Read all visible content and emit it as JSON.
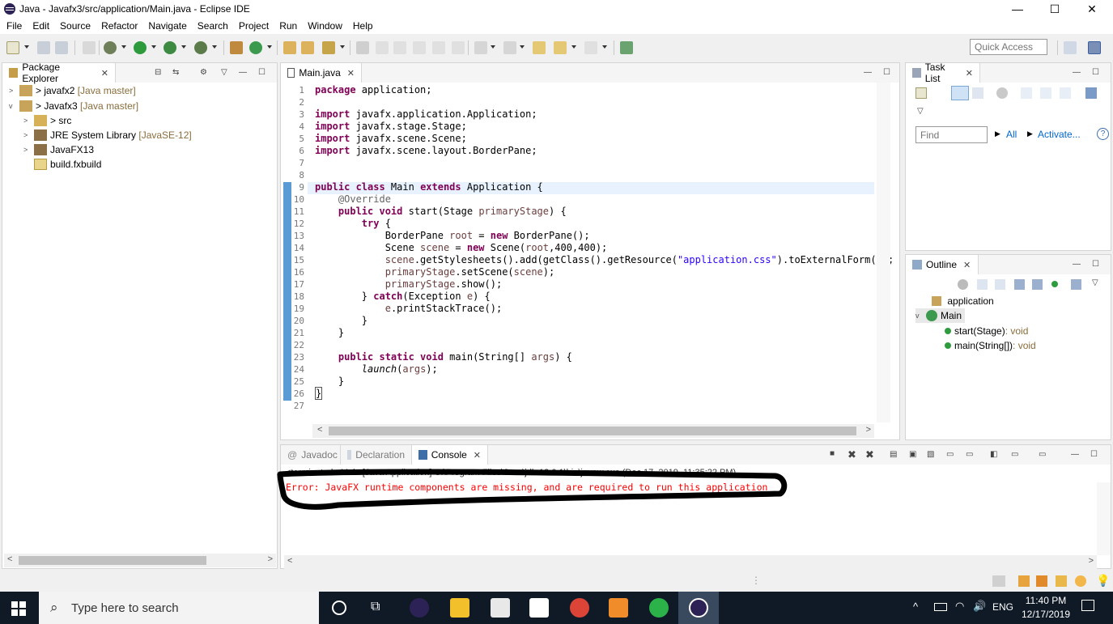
{
  "window": {
    "title": "Java - Javafx3/src/application/Main.java - Eclipse IDE",
    "min": "—",
    "max": "☐",
    "close": "✕"
  },
  "menu": [
    "File",
    "Edit",
    "Source",
    "Refactor",
    "Navigate",
    "Search",
    "Project",
    "Run",
    "Window",
    "Help"
  ],
  "toolbar": {
    "quick_access": "Quick Access"
  },
  "package_explorer": {
    "tab": "Package Explorer",
    "items": [
      {
        "label": "> javafx2",
        "tag": "[Java master]"
      },
      {
        "label": "> Javafx3",
        "tag": "[Java master]"
      },
      {
        "label": "> src",
        "tag": ""
      },
      {
        "label": "JRE System Library",
        "tag": "[JavaSE-12]"
      },
      {
        "label": "JavaFX13",
        "tag": ""
      },
      {
        "label": "build.fxbuild",
        "tag": ""
      }
    ]
  },
  "editor": {
    "tab": "Main.java",
    "line_numbers": [
      "1",
      "2",
      "3",
      "4",
      "5",
      "6",
      "7",
      "8",
      "9",
      "10",
      "11",
      "12",
      "13",
      "14",
      "15",
      "16",
      "17",
      "18",
      "19",
      "20",
      "21",
      "22",
      "23",
      "24",
      "25",
      "26",
      "27"
    ]
  },
  "task_list": {
    "tab": "Task List",
    "find_placeholder": "Find",
    "all": "All",
    "activate": "Activate..."
  },
  "outline": {
    "tab": "Outline",
    "items": [
      {
        "label": "application",
        "type": ""
      },
      {
        "label": "Main",
        "type": ""
      },
      {
        "label": "start(Stage)",
        "type": " : void"
      },
      {
        "label": "main(String[])",
        "type": " : void"
      }
    ]
  },
  "bottom": {
    "tabs": [
      "Javadoc",
      "Declaration",
      "Console"
    ],
    "terminated": "<terminated> Main [Java Application] C:\\Program Files\\Java\\jdk-13.0.1\\bin\\javaw.exe (Dec 17, 2019, 11:35:22 PM)",
    "error": "Error: JavaFX runtime components are missing, and are required to run this application"
  },
  "taskbar": {
    "search_placeholder": "Type here to search",
    "lang": "ENG",
    "time": "11:40 PM",
    "date": "12/17/2019"
  },
  "colors": {
    "error_red": "#ff0000",
    "accent_blue": "#0078d7",
    "keyword": "#7f0055",
    "string": "#2a00ff"
  }
}
